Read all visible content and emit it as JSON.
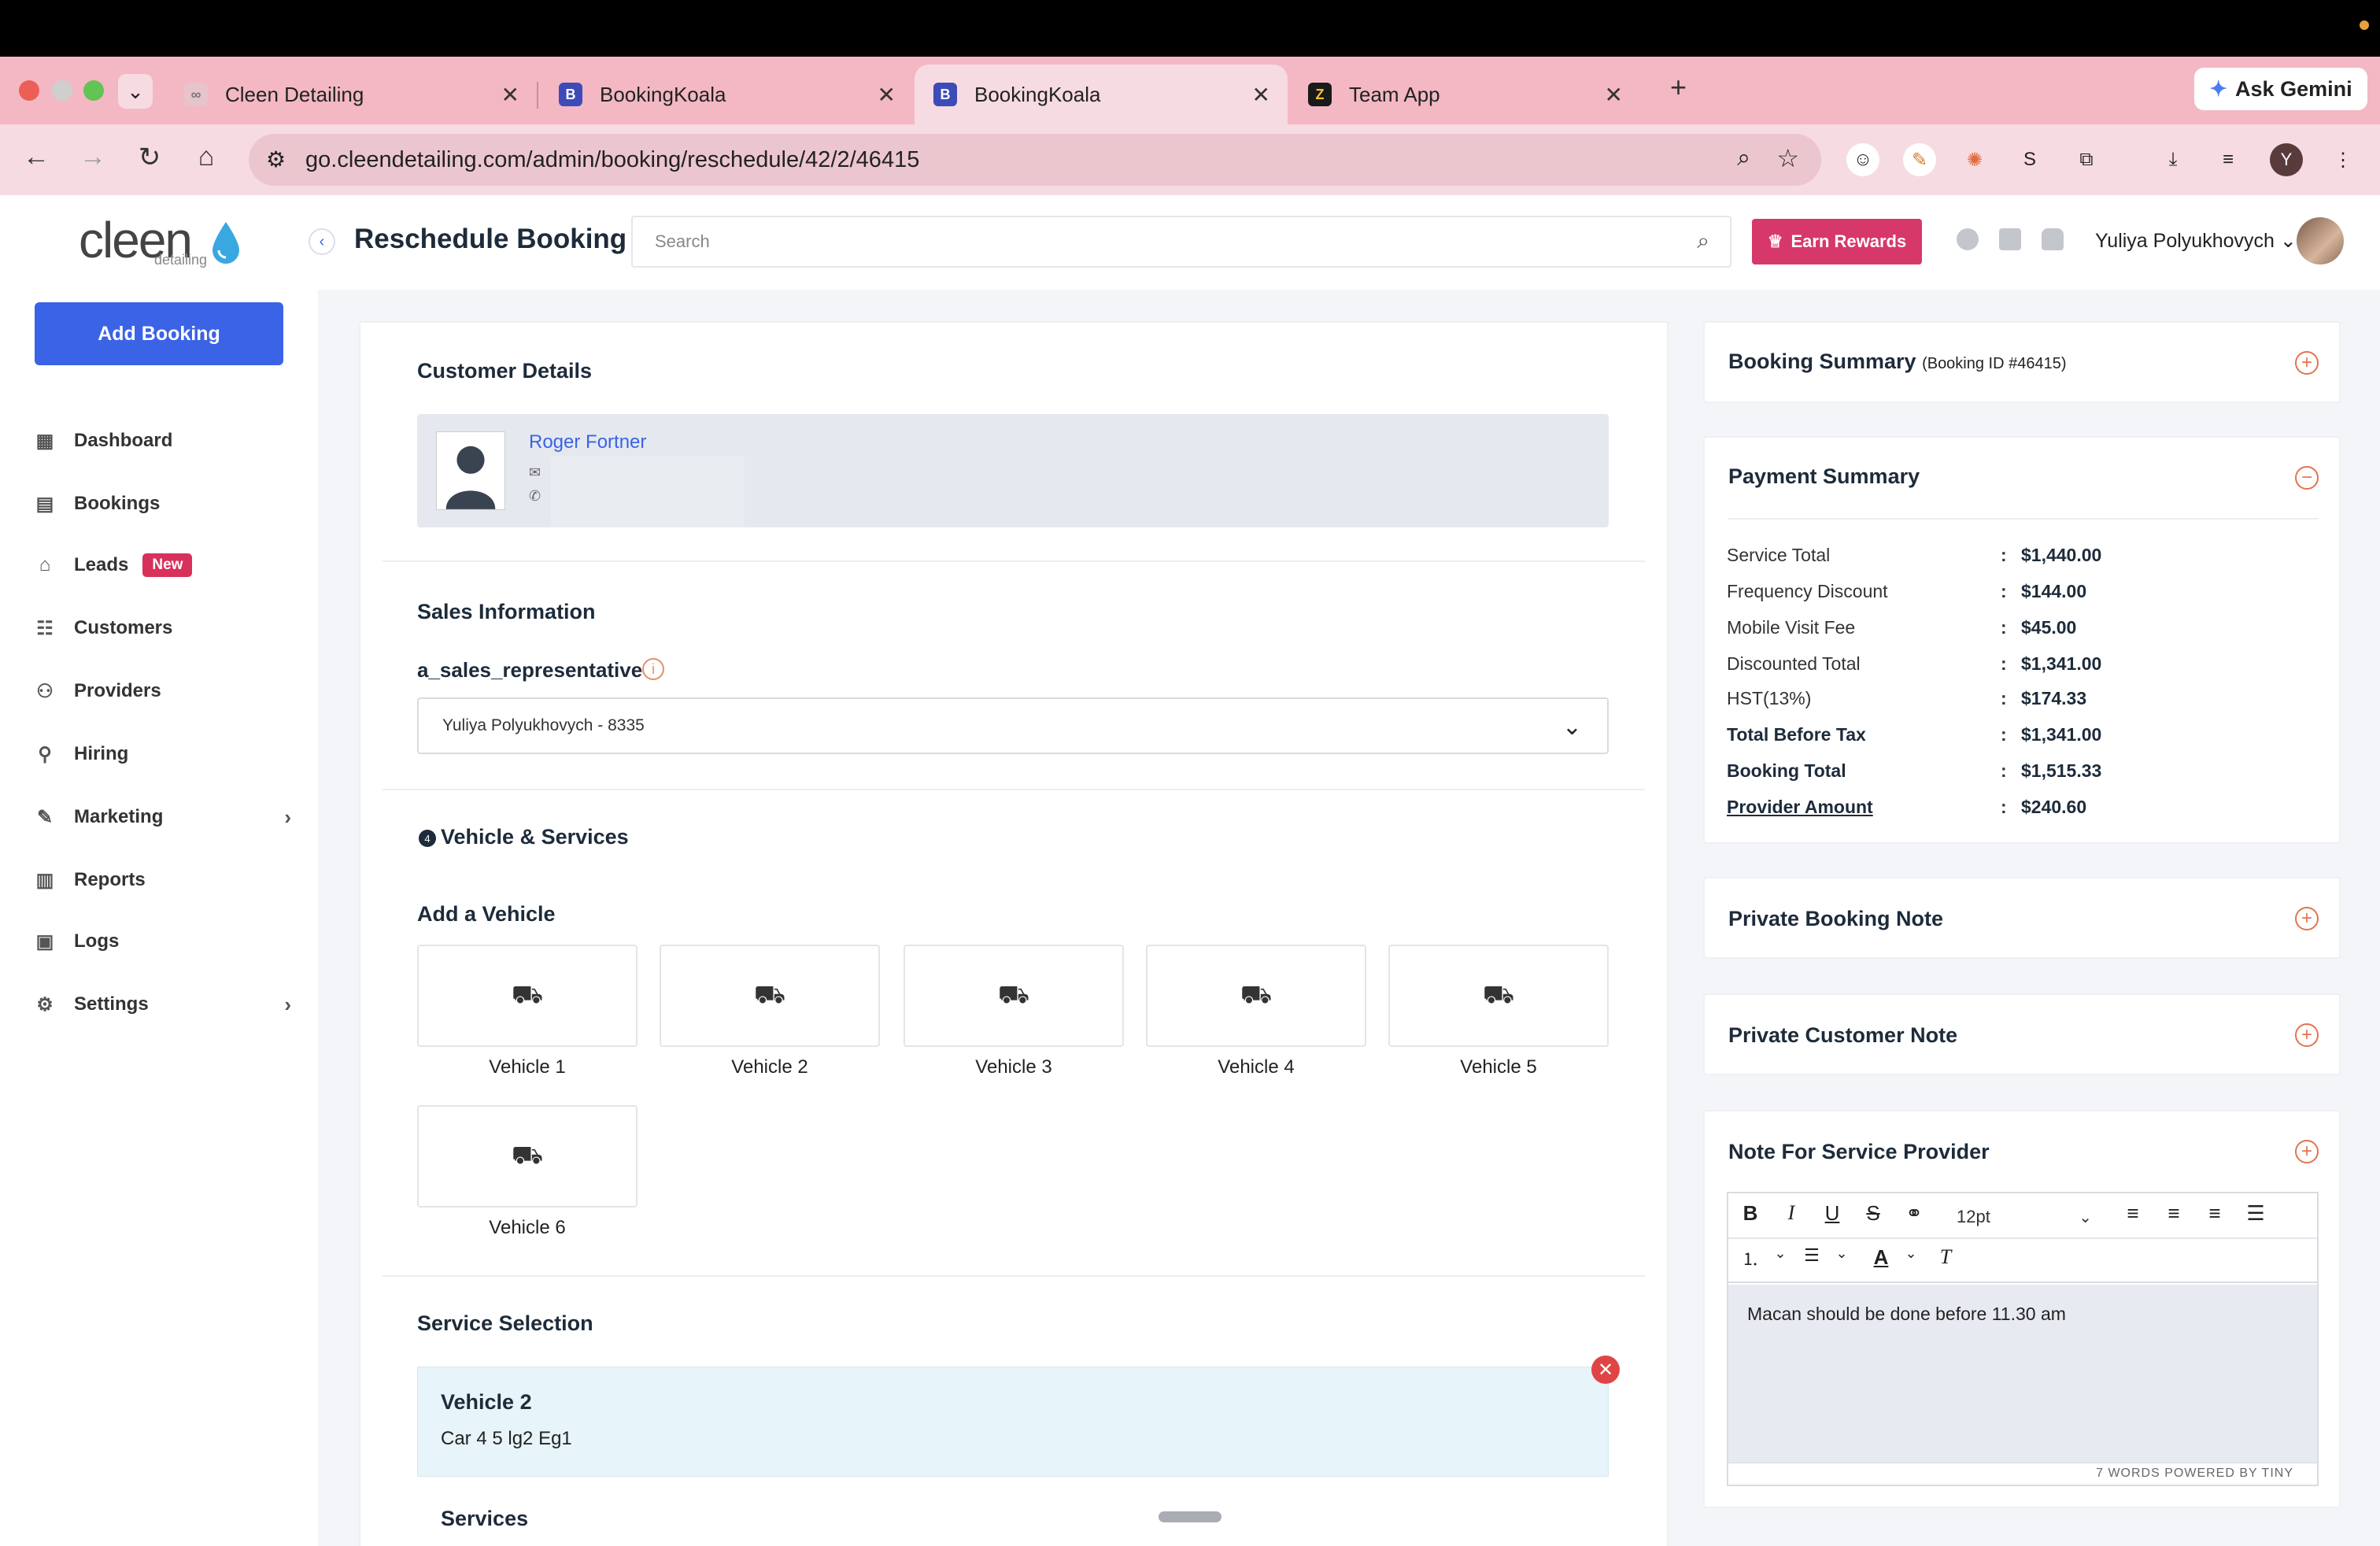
{
  "browser": {
    "tabs": [
      {
        "label": "Cleen Detailing"
      },
      {
        "label": "BookingKoala"
      },
      {
        "label": "BookingKoala"
      },
      {
        "label": "Team App"
      }
    ],
    "url": "go.cleendetailing.com/admin/booking/reschedule/42/2/46415",
    "ask_gemini": "Ask Gemini",
    "profile_initial": "Y"
  },
  "logo": {
    "name": "cleen",
    "sub": "detailing"
  },
  "sidebar": {
    "add_booking": "Add Booking",
    "items": [
      {
        "label": "Dashboard",
        "icon": "dashboard-icon"
      },
      {
        "label": "Bookings",
        "icon": "calendar-icon"
      },
      {
        "label": "Leads",
        "icon": "leads-icon",
        "badge": "New"
      },
      {
        "label": "Customers",
        "icon": "customers-icon"
      },
      {
        "label": "Providers",
        "icon": "providers-icon"
      },
      {
        "label": "Hiring",
        "icon": "hiring-icon"
      },
      {
        "label": "Marketing",
        "icon": "marketing-icon"
      },
      {
        "label": "Reports",
        "icon": "reports-icon"
      },
      {
        "label": "Logs",
        "icon": "logs-icon"
      },
      {
        "label": "Settings",
        "icon": "settings-icon"
      }
    ]
  },
  "header": {
    "title": "Reschedule Booking",
    "search_placeholder": "Search",
    "earn_rewards": "Earn Rewards",
    "user_name": "Yuliya Polyukhovych"
  },
  "customer": {
    "section_title": "Customer Details",
    "name": "Roger Fortner"
  },
  "sales": {
    "section_title": "Sales Information",
    "field_label": "a_sales_representative",
    "selected": "Yuliya Polyukhovych - 8335"
  },
  "vehicles": {
    "section_title": "Vehicle & Services",
    "step_number": "4",
    "add_title": "Add a Vehicle",
    "list": [
      "Vehicle 1",
      "Vehicle 2",
      "Vehicle 3",
      "Vehicle 4",
      "Vehicle 5",
      "Vehicle 6"
    ]
  },
  "service_selection": {
    "section_title": "Service Selection",
    "vehicle_title": "Vehicle 2",
    "vehicle_sub": "Car 4 5 lg2 Eg1",
    "services_label": "Services"
  },
  "booking_summary": {
    "title": "Booking Summary",
    "id_text": "(Booking ID #46415)"
  },
  "payment_summary": {
    "title": "Payment Summary",
    "rows": [
      {
        "label": "Service Total",
        "value": "$1,440.00"
      },
      {
        "label": "Frequency Discount",
        "value": "$144.00"
      },
      {
        "label": "Mobile Visit Fee",
        "value": "$45.00"
      },
      {
        "label": "Discounted Total",
        "value": "$1,341.00"
      },
      {
        "label": "HST(13%)",
        "value": "$174.33"
      },
      {
        "label": "Total Before Tax",
        "value": "$1,341.00"
      },
      {
        "label": "Booking Total",
        "value": "$1,515.33"
      },
      {
        "label": "Provider Amount",
        "value": "$240.60"
      }
    ]
  },
  "notes": {
    "private_booking": "Private Booking Note",
    "private_customer": "Private Customer Note",
    "service_provider": "Note For Service Provider"
  },
  "editor": {
    "font_size": "12pt",
    "content": "Macan should be done before 11.30 am",
    "status": "7 WORDS  POWERED BY TINY"
  },
  "colors": {
    "accent": "#3b63e6",
    "rewards": "#d6386a",
    "tab_bar": "#f3b8c4"
  }
}
